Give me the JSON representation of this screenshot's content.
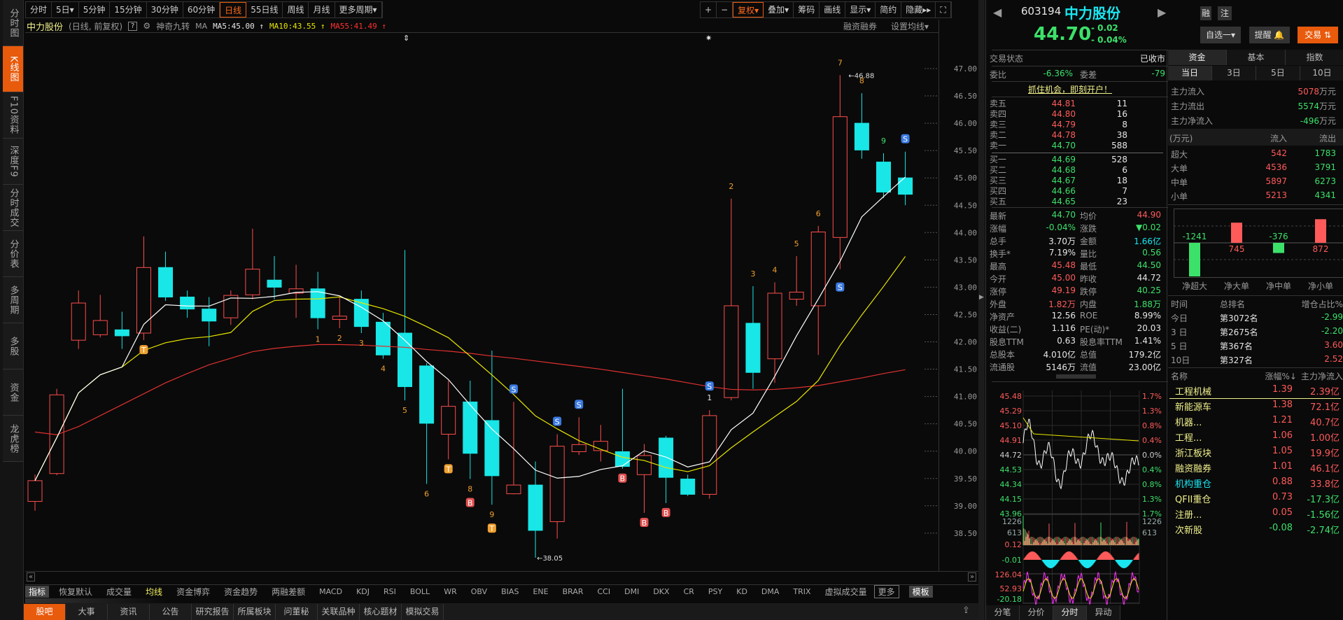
{
  "sidebar": {
    "items": [
      "分时图",
      "K线图",
      "F10资料",
      "深度F9",
      "分时成交",
      "分价表",
      "多周期",
      "多股",
      "资金",
      "龙虎榜"
    ],
    "active": 1
  },
  "toolbar": {
    "periods": [
      "分时",
      "5日▾",
      "5分钟",
      "15分钟",
      "30分钟",
      "60分钟",
      "日线",
      "55日线",
      "周线",
      "月线",
      "更多周期▾"
    ],
    "active": 6,
    "right": [
      "+",
      "−",
      "复权▾",
      "叠加▾",
      "筹码",
      "画线",
      "显示▾",
      "简约",
      "隐藏▸▸",
      "⛶"
    ],
    "right_active": 2
  },
  "info": {
    "name": "中力股份",
    "mode": "(日线, 前复权)",
    "help": "?",
    "indicator": "神奇九转",
    "ma_label": "MA",
    "ma5": "MA5:45.00 ↑",
    "ma10": "MA10:43.55 ↑",
    "ma55": "MA55:41.49 ↑",
    "margin": "融资融券",
    "set_ma": "设置均线▾"
  },
  "colors": {
    "up": "#ff4d4d",
    "down": "#19e6e6",
    "ma5": "#ffffff",
    "ma10": "#e6e600",
    "ma55": "#e03030",
    "accent": "#e85a0c"
  },
  "chart_data": {
    "type": "candlestick",
    "ylim": [
      38.2,
      47.2
    ],
    "yticks": [
      "47.00",
      "46.50",
      "46.00",
      "45.50",
      "45.00",
      "44.50",
      "44.00",
      "43.50",
      "43.00",
      "42.50",
      "42.00",
      "41.50",
      "41.00",
      "40.50",
      "40.00",
      "39.50",
      "39.00",
      "38.50"
    ],
    "ohlc": [
      [
        39.08,
        39.57,
        38.91,
        39.46
      ],
      [
        39.59,
        41.14,
        39.56,
        41.03
      ],
      [
        42.03,
        42.94,
        41.87,
        42.71
      ],
      [
        42.13,
        42.86,
        42.08,
        42.39
      ],
      [
        42.22,
        42.55,
        41.87,
        42.11
      ],
      [
        42.16,
        43.93,
        42.03,
        43.36
      ],
      [
        43.36,
        43.65,
        42.75,
        42.82
      ],
      [
        42.82,
        42.94,
        42.44,
        42.6
      ],
      [
        42.6,
        42.82,
        41.92,
        42.38
      ],
      [
        42.44,
        42.94,
        42.31,
        42.85
      ],
      [
        42.86,
        44.07,
        42.78,
        43.33
      ],
      [
        43.13,
        43.57,
        42.78,
        43.0
      ],
      [
        42.89,
        43.41,
        42.44,
        42.97
      ],
      [
        42.97,
        43.28,
        42.23,
        42.44
      ],
      [
        42.41,
        42.82,
        42.25,
        42.47
      ],
      [
        42.78,
        42.94,
        42.16,
        42.28
      ],
      [
        42.36,
        42.53,
        41.69,
        41.76
      ],
      [
        42.16,
        43.68,
        40.93,
        41.18
      ],
      [
        41.56,
        41.61,
        39.4,
        40.51
      ],
      [
        40.31,
        41.29,
        39.85,
        40.82
      ],
      [
        40.9,
        41.29,
        39.49,
        39.96
      ],
      [
        40.56,
        41.84,
        39.02,
        39.55
      ],
      [
        39.22,
        40.9,
        39.21,
        39.38
      ],
      [
        39.38,
        39.81,
        38.05,
        38.55
      ],
      [
        38.71,
        40.31,
        38.4,
        40.09
      ],
      [
        39.99,
        40.62,
        39.93,
        40.12
      ],
      [
        40.01,
        40.48,
        39.81,
        40.18
      ],
      [
        39.99,
        41.14,
        39.68,
        39.72
      ],
      [
        39.57,
        40.13,
        38.87,
        39.92
      ],
      [
        40.24,
        40.28,
        39.05,
        39.52
      ],
      [
        39.49,
        39.57,
        39.18,
        39.21
      ],
      [
        39.21,
        40.75,
        39.13,
        40.65
      ],
      [
        40.98,
        44.62,
        40.93,
        42.66
      ],
      [
        42.34,
        43.02,
        41.14,
        41.44
      ],
      [
        41.69,
        43.09,
        41.25,
        42.89
      ],
      [
        42.78,
        43.57,
        42.66,
        42.91
      ],
      [
        42.66,
        44.12,
        41.76,
        44.01
      ],
      [
        43.91,
        46.88,
        43.33,
        46.12
      ],
      [
        46.0,
        46.55,
        45.35,
        45.51
      ],
      [
        45.29,
        45.45,
        44.63,
        44.74
      ],
      [
        45.0,
        45.48,
        44.5,
        44.7
      ]
    ],
    "ma55": [
      40.35,
      40.3,
      40.45,
      40.65,
      40.85,
      41.05,
      41.25,
      41.42,
      41.58,
      41.7,
      41.82,
      41.88,
      41.92,
      41.95,
      41.95,
      41.94,
      41.92,
      41.9,
      41.86,
      41.83,
      41.79,
      41.74,
      41.7,
      41.65,
      41.6,
      41.55,
      41.5,
      41.44,
      41.38,
      41.32,
      41.25,
      41.18,
      41.13,
      41.12,
      41.13,
      41.16,
      41.2,
      41.27,
      41.34,
      41.42,
      41.49
    ],
    "markers": [
      {
        "i": 5,
        "label": "T",
        "pos": "below",
        "color": "#f0a030",
        "box": true
      },
      {
        "i": 13,
        "label": "1",
        "pos": "below",
        "color": "#f0a030"
      },
      {
        "i": 14,
        "label": "2",
        "pos": "below",
        "color": "#f0a030"
      },
      {
        "i": 15,
        "label": "3",
        "pos": "below",
        "color": "#f0a030"
      },
      {
        "i": 16,
        "label": "4",
        "pos": "below",
        "color": "#f0a030"
      },
      {
        "i": 17,
        "label": "5",
        "pos": "below",
        "color": "#f0a030"
      },
      {
        "i": 18,
        "label": "6",
        "pos": "below",
        "color": "#f0a030"
      },
      {
        "i": 19,
        "label": "T",
        "pos": "below",
        "color": "#f0a030",
        "box": true
      },
      {
        "i": 20,
        "label": "8",
        "pos": "below",
        "color": "#f0a030"
      },
      {
        "i": 20,
        "label": "B",
        "pos": "below2",
        "color": "#e05050",
        "box": true
      },
      {
        "i": 21,
        "label": "9",
        "pos": "below",
        "color": "#f0a030"
      },
      {
        "i": 21,
        "label": "T",
        "pos": "below2",
        "color": "#f0a030",
        "box": true
      },
      {
        "i": 22,
        "label": "S",
        "pos": "above",
        "color": "#3a7ae0",
        "box": true
      },
      {
        "i": 24,
        "label": "S",
        "pos": "above",
        "color": "#3a7ae0",
        "box": true
      },
      {
        "i": 25,
        "label": "S",
        "pos": "above",
        "color": "#3a7ae0",
        "box": true
      },
      {
        "i": 27,
        "label": "B",
        "pos": "below",
        "color": "#e05050",
        "box": true
      },
      {
        "i": 28,
        "label": "B",
        "pos": "below",
        "color": "#e05050",
        "box": true
      },
      {
        "i": 29,
        "label": "B",
        "pos": "below",
        "color": "#e05050",
        "box": true
      },
      {
        "i": 31,
        "label": "S",
        "pos": "above2",
        "color": "#3a7ae0",
        "box": true
      },
      {
        "i": 31,
        "label": "1",
        "pos": "above",
        "color": "#e6e6e6"
      },
      {
        "i": 32,
        "label": "2",
        "pos": "above",
        "color": "#f0a030"
      },
      {
        "i": 33,
        "label": "3",
        "pos": "above",
        "color": "#f0a030"
      },
      {
        "i": 34,
        "label": "4",
        "pos": "above",
        "color": "#f0a030"
      },
      {
        "i": 35,
        "label": "5",
        "pos": "above",
        "color": "#f0a030"
      },
      {
        "i": 36,
        "label": "6",
        "pos": "above",
        "color": "#f0a030"
      },
      {
        "i": 37,
        "label": "7",
        "pos": "above",
        "color": "#f0a030"
      },
      {
        "i": 37,
        "label": "S",
        "pos": "belowlow",
        "color": "#3a7ae0",
        "box": true
      },
      {
        "i": 38,
        "label": "8",
        "pos": "above",
        "color": "#f0a030"
      },
      {
        "i": 39,
        "label": "9",
        "pos": "above",
        "color": "#3ce16a"
      },
      {
        "i": 40,
        "label": "S",
        "pos": "above",
        "color": "#3a7ae0",
        "box": true
      }
    ],
    "high_label": "46.88",
    "low_label": "38.05"
  },
  "indicators": {
    "title": "指标",
    "items": [
      "恢复默认",
      "成交量",
      "均线",
      "资金博弈",
      "资金趋势",
      "两融差额",
      "MACD",
      "KDJ",
      "RSI",
      "BOLL",
      "WR",
      "OBV",
      "BIAS",
      "ENE",
      "BRAR",
      "CCI",
      "DMI",
      "DKX",
      "CR",
      "PSY",
      "KD",
      "DMA",
      "TRIX",
      "虚拟成交量"
    ],
    "active": 2,
    "more": "更多",
    "template": "模板"
  },
  "bottom_tabs": {
    "items": [
      "股吧",
      "大事",
      "资讯",
      "公告",
      "研究报告",
      "所属板块",
      "问董秘",
      "关联品种",
      "核心题材",
      "模拟交易"
    ],
    "active": 0
  },
  "quote": {
    "code": "603194",
    "name": "中力股份",
    "price": "44.70",
    "change": "- 0.02",
    "pct": "- 0.04%",
    "tag1": "融",
    "tag2": "注",
    "watch": "自选一▾",
    "alert": "提醒 🔔",
    "trade": "交易 ⇅",
    "status_label": "交易状态",
    "status": "已收市",
    "wb_label": "委比",
    "wb": "-6.36%",
    "wc_label": "委差",
    "wc": "-79",
    "banner": "抓住机会，即刻开户！"
  },
  "orderbook": {
    "asks": [
      [
        "卖五",
        "44.81",
        "11"
      ],
      [
        "卖四",
        "44.80",
        "16"
      ],
      [
        "卖三",
        "44.79",
        "8"
      ],
      [
        "卖二",
        "44.78",
        "38"
      ],
      [
        "卖一",
        "44.70",
        "588"
      ]
    ],
    "bids": [
      [
        "买一",
        "44.69",
        "528"
      ],
      [
        "买二",
        "44.68",
        "6"
      ],
      [
        "买三",
        "44.67",
        "18"
      ],
      [
        "买四",
        "44.66",
        "7"
      ],
      [
        "买五",
        "44.65",
        "23"
      ]
    ]
  },
  "stats": [
    [
      "最新",
      "44.70",
      "grn",
      "均价",
      "44.90",
      "red"
    ],
    [
      "涨幅",
      "-0.04%",
      "grn",
      "涨跌",
      "▼0.02",
      "grn"
    ],
    [
      "总手",
      "3.70万",
      "wht",
      "金额",
      "1.66亿",
      "cyn"
    ],
    [
      "换手*",
      "7.19%",
      "wht",
      "量比",
      "0.56",
      "grn"
    ],
    [
      "最高",
      "45.48",
      "red",
      "最低",
      "44.50",
      "grn"
    ],
    [
      "今开",
      "45.00",
      "red",
      "昨收",
      "44.72",
      "wht"
    ],
    [
      "涨停",
      "49.19",
      "red",
      "跌停",
      "40.25",
      "grn"
    ],
    [
      "外盘",
      "1.82万",
      "red",
      "内盘",
      "1.88万",
      "grn"
    ],
    [
      "净资产",
      "12.56",
      "wht",
      "ROE",
      "8.99%",
      "wht"
    ],
    [
      "收益(二)",
      "1.116",
      "wht",
      "PE(动)*",
      "20.03",
      "wht"
    ],
    [
      "股息TTM",
      "0.63",
      "wht",
      "股息率TTM",
      "1.41%",
      "wht"
    ],
    [
      "总股本",
      "4.010亿",
      "wht",
      "总值",
      "179.2亿",
      "wht"
    ],
    [
      "流通股",
      "5146万",
      "wht",
      "流值",
      "23.00亿",
      "wht"
    ]
  ],
  "funds": {
    "tabs": [
      "资金",
      "基本",
      "指数"
    ],
    "periods": [
      "当日",
      "3日",
      "5日",
      "10日"
    ],
    "main": [
      [
        "主力流入",
        "5078",
        "万元",
        "red"
      ],
      [
        "主力流出",
        "5574",
        "万元",
        "grn"
      ],
      [
        "主力净流入",
        "-496",
        "万元",
        "grn"
      ]
    ],
    "table_header": [
      "(万元)",
      "流入",
      "流出"
    ],
    "table": [
      [
        "超大",
        "542",
        "1783"
      ],
      [
        "大单",
        "4536",
        "3791"
      ],
      [
        "中单",
        "5897",
        "6273"
      ],
      [
        "小单",
        "5213",
        "4341"
      ]
    ],
    "net": [
      {
        "label": "净超大",
        "value": -1241
      },
      {
        "label": "净大单",
        "value": 745
      },
      {
        "label": "净中单",
        "value": -376
      },
      {
        "label": "净小单",
        "value": 872
      }
    ],
    "rank_header": [
      "时间",
      "总排名",
      "增仓占比%"
    ],
    "rank": [
      [
        "今日",
        "第3072名",
        "-2.99",
        "grn"
      ],
      [
        "3 日",
        "第2675名",
        "-2.20",
        "grn"
      ],
      [
        "5 日",
        "第367名",
        "3.60",
        "red"
      ],
      [
        "10日",
        "第327名",
        "2.52",
        "red"
      ]
    ]
  },
  "sectors": {
    "header": [
      "名称",
      "涨幅%↓",
      "主力净流入"
    ],
    "rows": [
      [
        "工程机械",
        "1.39",
        "2.39亿",
        "yel",
        "red",
        "red"
      ],
      [
        "新能源车",
        "1.38",
        "72.1亿",
        "yel",
        "red",
        "red"
      ],
      [
        "机器...",
        "1.21",
        "40.7亿",
        "yel",
        "red",
        "red"
      ],
      [
        "工程...",
        "1.06",
        "1.00亿",
        "yel",
        "red",
        "red"
      ],
      [
        "浙江板块",
        "1.05",
        "19.9亿",
        "yel",
        "red",
        "red"
      ],
      [
        "融资融券",
        "1.01",
        "46.1亿",
        "yel",
        "red",
        "red"
      ],
      [
        "机构重仓",
        "0.88",
        "33.8亿",
        "cyn",
        "red",
        "red"
      ],
      [
        "QFII重仓",
        "0.73",
        "-17.3亿",
        "yel",
        "red",
        "grn"
      ],
      [
        "注册...",
        "0.05",
        "-1.56亿",
        "yel",
        "red",
        "grn"
      ],
      [
        "次新股",
        "-0.08",
        "-2.74亿",
        "yel",
        "grn",
        "grn"
      ]
    ]
  },
  "mini": {
    "price_left": [
      "45.48",
      "45.29",
      "45.10",
      "44.91",
      "44.72",
      "44.53",
      "44.34",
      "44.15",
      "43.96"
    ],
    "price_right": [
      "1.7%",
      "1.3%",
      "0.8%",
      "0.4%",
      "0.0%",
      "0.4%",
      "0.8%",
      "1.3%",
      "1.7%"
    ],
    "vol": [
      "1226",
      "613",
      "0.12"
    ],
    "vol_right": [
      "1226",
      "613"
    ],
    "macd": [
      "-0.01"
    ],
    "kdj": [
      "126.04",
      "52.93",
      "-20.18"
    ],
    "tabs": [
      "分笔",
      "分价",
      "分时",
      "异动"
    ],
    "active": 2
  }
}
